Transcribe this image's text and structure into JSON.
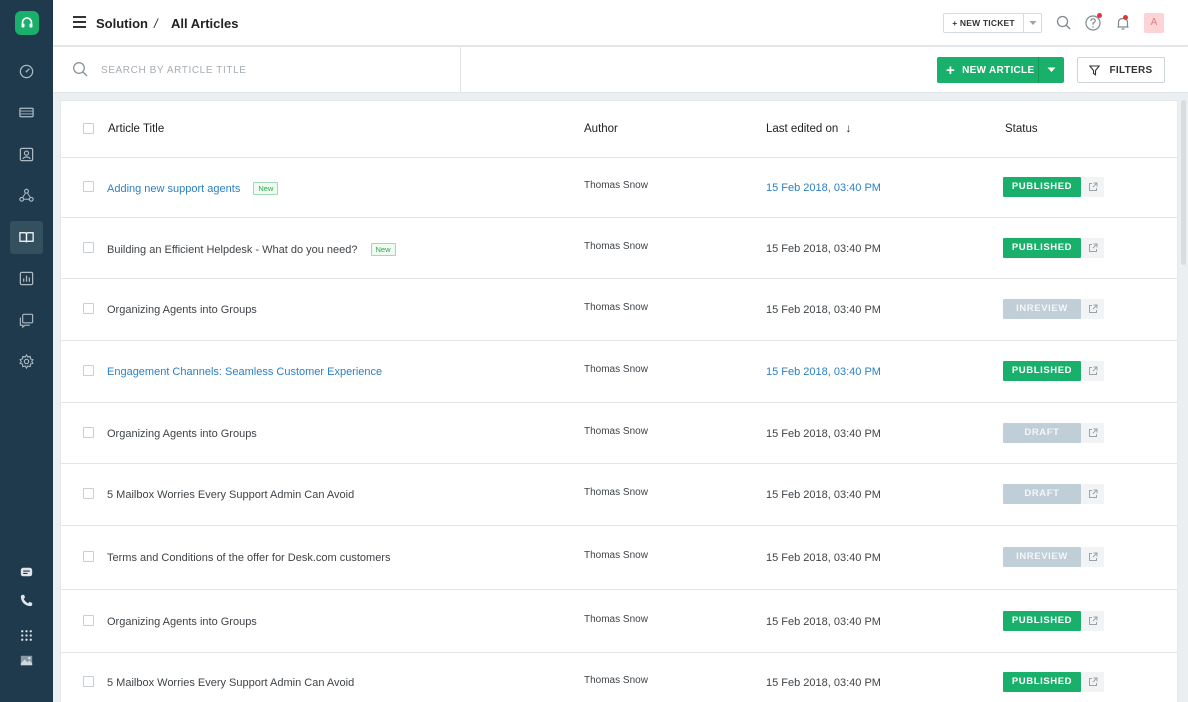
{
  "header": {
    "breadcrumb": [
      "Solution",
      "All Articles"
    ],
    "separator": "/",
    "new_ticket_label": "NEW TICKET",
    "avatar_initial": "A"
  },
  "toolbar": {
    "search_placeholder": "SEARCH BY ARTICLE TITLE",
    "new_article_label": "NEW ARTICLE",
    "filters_label": "FILTERS"
  },
  "table": {
    "columns": [
      "Article Title",
      "Author",
      "Last edited on",
      "Status"
    ],
    "sort_indicator": "↓",
    "rows": [
      {
        "title": "Adding new support agents",
        "is_new": true,
        "new_label": "New",
        "author": "Thomas Snow",
        "date": "15 Feb 2018, 03:40 PM",
        "status": "PUBLISHED",
        "highlight": true
      },
      {
        "title": "Building an Efficient Helpdesk - What do you need?",
        "is_new": true,
        "new_label": "New",
        "author": "Thomas Snow",
        "date": "15 Feb 2018, 03:40 PM",
        "status": "PUBLISHED",
        "highlight": false
      },
      {
        "title": "Organizing Agents into Groups",
        "is_new": false,
        "new_label": "",
        "author": "Thomas Snow",
        "date": "15 Feb 2018, 03:40 PM",
        "status": "INREVIEW",
        "highlight": false
      },
      {
        "title": "Engagement Channels: Seamless Customer Experience",
        "is_new": false,
        "new_label": "",
        "author": "Thomas Snow",
        "date": "15 Feb 2018, 03:40 PM",
        "status": "PUBLISHED",
        "highlight": true
      },
      {
        "title": "Organizing Agents into Groups",
        "is_new": false,
        "new_label": "",
        "author": "Thomas Snow",
        "date": "15 Feb 2018, 03:40 PM",
        "status": "DRAFT",
        "highlight": false
      },
      {
        "title": "5 Mailbox Worries Every Support Admin Can Avoid",
        "is_new": false,
        "new_label": "",
        "author": "Thomas Snow",
        "date": "15 Feb 2018, 03:40 PM",
        "status": "DRAFT",
        "highlight": false
      },
      {
        "title": "Terms and Conditions of the offer for Desk.com customers",
        "is_new": false,
        "new_label": "",
        "author": "Thomas Snow",
        "date": "15 Feb 2018, 03:40 PM",
        "status": "INREVIEW",
        "highlight": false
      },
      {
        "title": "Organizing Agents into Groups",
        "is_new": false,
        "new_label": "",
        "author": "Thomas Snow",
        "date": "15 Feb 2018, 03:40 PM",
        "status": "PUBLISHED",
        "highlight": false
      },
      {
        "title": "5 Mailbox Worries Every Support Admin Can Avoid",
        "is_new": false,
        "new_label": "",
        "author": "Thomas Snow",
        "date": "15 Feb 2018, 03:40 PM",
        "status": "PUBLISHED",
        "highlight": false
      }
    ]
  },
  "sidebar": {
    "items": [
      {
        "icon": "dashboard-icon",
        "active": false
      },
      {
        "icon": "tickets-icon",
        "active": false
      },
      {
        "icon": "contacts-icon",
        "active": false
      },
      {
        "icon": "groups-icon",
        "active": false
      },
      {
        "icon": "solutions-icon",
        "active": true
      },
      {
        "icon": "reports-icon",
        "active": false
      },
      {
        "icon": "social-icon",
        "active": false
      },
      {
        "icon": "admin-icon",
        "active": false
      }
    ],
    "bottom_items": [
      "chat-icon",
      "phone-icon",
      "apps-icon",
      "photo-icon"
    ]
  },
  "colors": {
    "brand_green": "#19b06b",
    "sidebar_bg": "#1f3a4d",
    "link_blue": "#2d80c2",
    "muted_status": "#c0ced7",
    "notification_red": "#e43538"
  }
}
